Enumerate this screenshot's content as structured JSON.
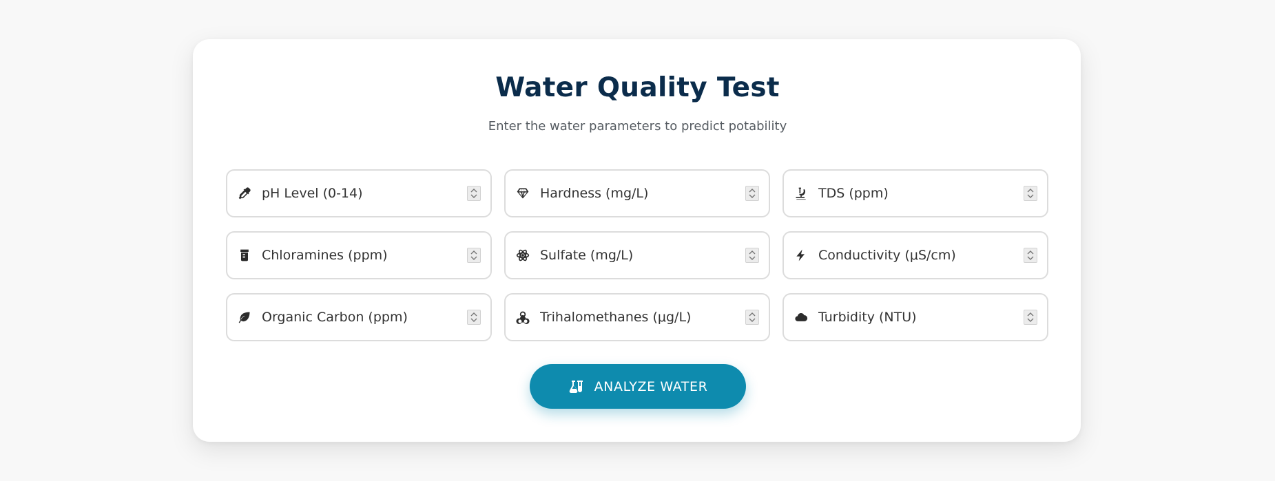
{
  "header": {
    "title": "Water Quality Test",
    "subtitle": "Enter the water parameters to predict potability"
  },
  "fields": [
    {
      "placeholder": "pH Level (0-14)",
      "icon": "eyedropper-icon"
    },
    {
      "placeholder": "Hardness (mg/L)",
      "icon": "gem-icon"
    },
    {
      "placeholder": "TDS (ppm)",
      "icon": "microscope-icon"
    },
    {
      "placeholder": "Chloramines (ppm)",
      "icon": "prescription-bottle-icon"
    },
    {
      "placeholder": "Sulfate (mg/L)",
      "icon": "atom-icon"
    },
    {
      "placeholder": "Conductivity (μS/cm)",
      "icon": "bolt-icon"
    },
    {
      "placeholder": "Organic Carbon (ppm)",
      "icon": "leaf-icon"
    },
    {
      "placeholder": "Trihalomethanes (μg/L)",
      "icon": "biohazard-icon"
    },
    {
      "placeholder": "Turbidity (NTU)",
      "icon": "cloud-icon"
    }
  ],
  "submit": {
    "label": "ANALYZE WATER",
    "icon": "flask-vial-icon"
  },
  "colors": {
    "title": "#0b2c4b",
    "accent": "#0e8bae",
    "background": "#f8f8f8"
  }
}
